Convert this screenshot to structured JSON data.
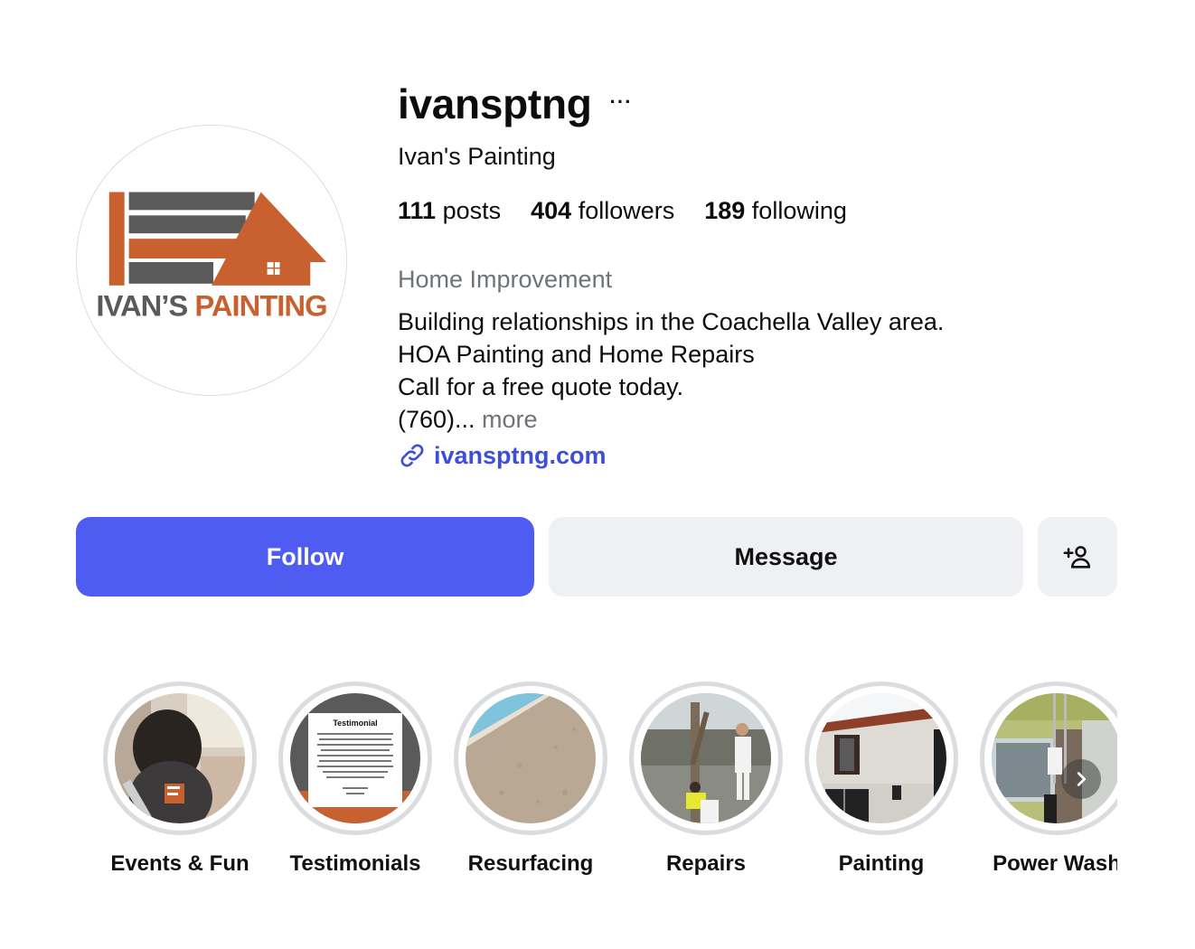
{
  "profile": {
    "username": "ivansptng",
    "more_label": "···",
    "full_name": "Ivan's Painting",
    "avatar_brand_text": "IVAN'S PAINTING",
    "stats": [
      {
        "count": "111",
        "label": " posts"
      },
      {
        "count": "404",
        "label": " followers"
      },
      {
        "count": "189",
        "label": " following"
      }
    ],
    "category": "Home Improvement",
    "bio_lines": [
      "Building relationships in the Coachella Valley area.",
      "HOA Painting and Home Repairs",
      "Call for a free quote today."
    ],
    "bio_truncated": "(760)...",
    "bio_more": " more",
    "link_text": "ivansptng.com",
    "link_icon": "link-icon"
  },
  "actions": {
    "follow_label": "Follow",
    "message_label": "Message",
    "add_icon": "add-person-icon"
  },
  "highlights": [
    {
      "label": "Events & Fun"
    },
    {
      "label": "Testimonials",
      "card_title": "Testimonial"
    },
    {
      "label": "Resurfacing"
    },
    {
      "label": "Repairs"
    },
    {
      "label": "Painting"
    },
    {
      "label": "Power Wash"
    }
  ],
  "colors": {
    "follow_bg": "#4e5cf2",
    "link": "#3d4fd8",
    "brand_orange": "#c8602f",
    "brand_gray": "#5a5a5a"
  }
}
